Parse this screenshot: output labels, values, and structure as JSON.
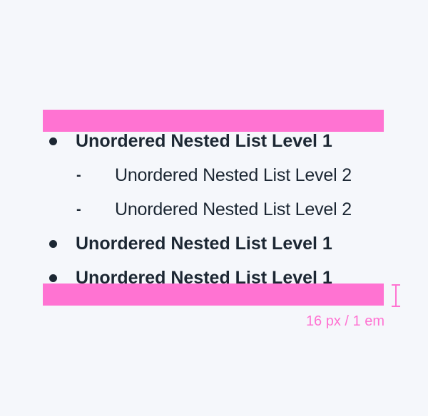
{
  "list": {
    "items": [
      {
        "level": 1,
        "bullet": "disc",
        "text": "Unordered Nested List Level  1"
      },
      {
        "level": 2,
        "bullet": "-",
        "text": "Unordered Nested List Level 2"
      },
      {
        "level": 2,
        "bullet": "-",
        "text": "Unordered Nested List Level 2"
      },
      {
        "level": 1,
        "bullet": "disc",
        "text": "Unordered Nested List Level 1"
      },
      {
        "level": 1,
        "bullet": "disc",
        "text": "Unordered Nested List Level 1"
      }
    ]
  },
  "spacing": {
    "label": "16 px / 1 em",
    "highlight_color": "#ff73d2",
    "icon": "vertical-measure-icon"
  },
  "colors": {
    "background": "#f5f7fb",
    "text": "#1c2733",
    "accent": "#ff73d2"
  }
}
